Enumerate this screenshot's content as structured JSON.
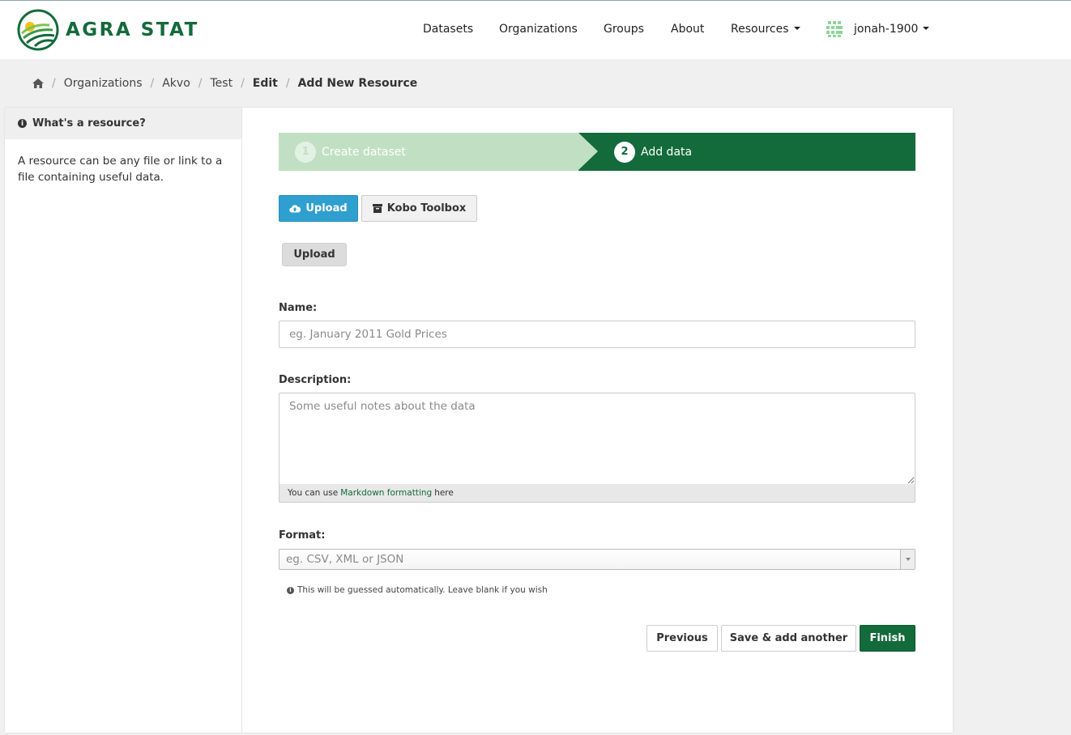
{
  "brand": {
    "name": "AGRA STAT",
    "color": "#136a3a"
  },
  "nav": {
    "items": [
      {
        "label": "Datasets"
      },
      {
        "label": "Organizations"
      },
      {
        "label": "Groups"
      },
      {
        "label": "About"
      },
      {
        "label": "Resources",
        "has_caret": true
      }
    ],
    "user": {
      "name": "jonah-1900",
      "icon": "user-avatar-grid-icon"
    }
  },
  "breadcrumb": {
    "home_icon": "home-icon",
    "items": [
      "Organizations",
      "Akvo",
      "Test",
      "Edit",
      "Add New Resource"
    ]
  },
  "sidebar": {
    "heading": "What's a resource?",
    "text": "A resource can be any file or link to a file containing useful data."
  },
  "steps": [
    {
      "number": "1",
      "label": "Create dataset",
      "state": "complete"
    },
    {
      "number": "2",
      "label": "Add data",
      "state": "active"
    }
  ],
  "source_buttons": {
    "upload": "Upload",
    "kobo": "Kobo Toolbox"
  },
  "upload_button": "Upload",
  "form": {
    "name": {
      "label": "Name:",
      "placeholder": "eg. January 2011 Gold Prices",
      "value": ""
    },
    "description": {
      "label": "Description:",
      "placeholder": "Some useful notes about the data",
      "value": "",
      "markdown_prefix": "You can use",
      "markdown_link": "Markdown formatting",
      "markdown_suffix": "here"
    },
    "format": {
      "label": "Format:",
      "placeholder": "eg. CSV, XML or JSON",
      "help": "This will be guessed automatically. Leave blank if you wish"
    }
  },
  "actions": {
    "previous": "Previous",
    "save_add": "Save & add another",
    "finish": "Finish"
  },
  "colors": {
    "primary": "#136a3a",
    "upload_blue": "#2f9fd0",
    "step_done": "#c1e0c3"
  }
}
